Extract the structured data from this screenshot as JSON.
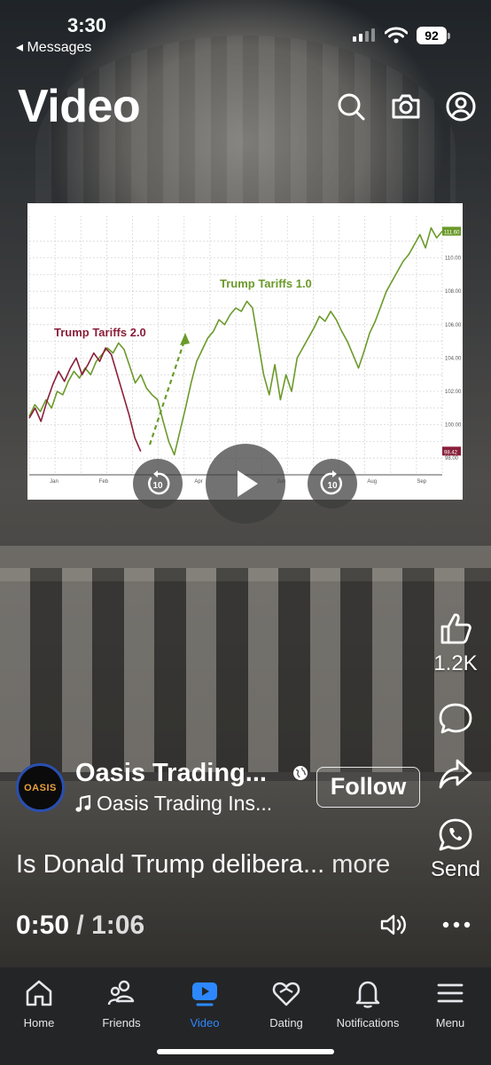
{
  "status_bar": {
    "time": "3:30",
    "back_label": "◂ Messages",
    "battery": "92"
  },
  "header": {
    "title": "Video",
    "icons": [
      "search-icon",
      "camera-icon",
      "profile-icon"
    ]
  },
  "video": {
    "chart_data": {
      "type": "line",
      "annotations": [
        "Trump Tariffs 1.0",
        "Trump Tariffs 2.0"
      ],
      "x_ticks": [
        "Jan",
        "Feb",
        "Apr",
        "Jun",
        "Aug",
        "Sep"
      ],
      "y_ticks": [
        "98.00",
        "100.00",
        "102.00",
        "104.00",
        "106.00",
        "108.00",
        "110.00"
      ],
      "ylim": [
        97,
        112
      ],
      "last_labels": [
        "111.60",
        "98.42"
      ],
      "series": [
        {
          "name": "Trump Tariffs 1.0",
          "color": "#6b9a2a",
          "values": [
            100.5,
            101.2,
            100.8,
            101.5,
            101.0,
            102.0,
            101.8,
            102.6,
            103.2,
            102.8,
            103.4,
            103.0,
            103.8,
            104.2,
            104.6,
            104.3,
            104.9,
            104.5,
            103.5,
            102.5,
            103.0,
            102.2,
            101.8,
            101.5,
            100.2,
            99.0,
            98.2,
            99.6,
            101.0,
            102.5,
            103.8,
            104.5,
            105.2,
            105.6,
            106.3,
            106.0,
            106.6,
            107.0,
            106.8,
            107.4,
            107.0,
            105.0,
            103.0,
            101.8,
            103.6,
            101.5,
            103.0,
            102.0,
            104.0,
            104.6,
            105.2,
            105.8,
            106.5,
            106.2,
            106.8,
            106.3,
            105.6,
            105.0,
            104.2,
            103.4,
            104.4,
            105.5,
            106.2,
            107.1,
            108.0,
            108.6,
            109.2,
            109.8,
            110.2,
            110.8,
            111.4,
            110.6,
            111.8,
            111.2,
            111.6
          ]
        },
        {
          "name": "Trump Tariffs 2.0",
          "color": "#8a1f3a",
          "values": [
            100.4,
            101.0,
            100.2,
            101.4,
            102.4,
            103.2,
            102.6,
            103.4,
            104.0,
            103.0,
            103.6,
            104.3,
            103.8,
            104.6,
            104.2,
            103.0,
            101.8,
            100.6,
            99.2,
            98.4
          ]
        }
      ]
    },
    "controls": {
      "rewind_label": "10",
      "forward_label": "10"
    }
  },
  "actions": {
    "like_count": "1.2K",
    "send_label": "Send"
  },
  "post": {
    "avatar_text": "OASIS",
    "author": "Oasis Trading...",
    "audio": "Oasis Trading Ins...",
    "follow_label": "Follow",
    "caption": "Is Donald Trump delibera...",
    "more_label": "more",
    "current_time": "0:50",
    "separator": "/",
    "total_time": "1:06"
  },
  "nav": {
    "items": [
      {
        "label": "Home",
        "icon": "home-icon"
      },
      {
        "label": "Friends",
        "icon": "friends-icon"
      },
      {
        "label": "Video",
        "icon": "video-icon",
        "active": true
      },
      {
        "label": "Dating",
        "icon": "dating-icon"
      },
      {
        "label": "Notifications",
        "icon": "bell-icon"
      },
      {
        "label": "Menu",
        "icon": "menu-icon"
      }
    ],
    "active_color": "#2d88ff"
  }
}
